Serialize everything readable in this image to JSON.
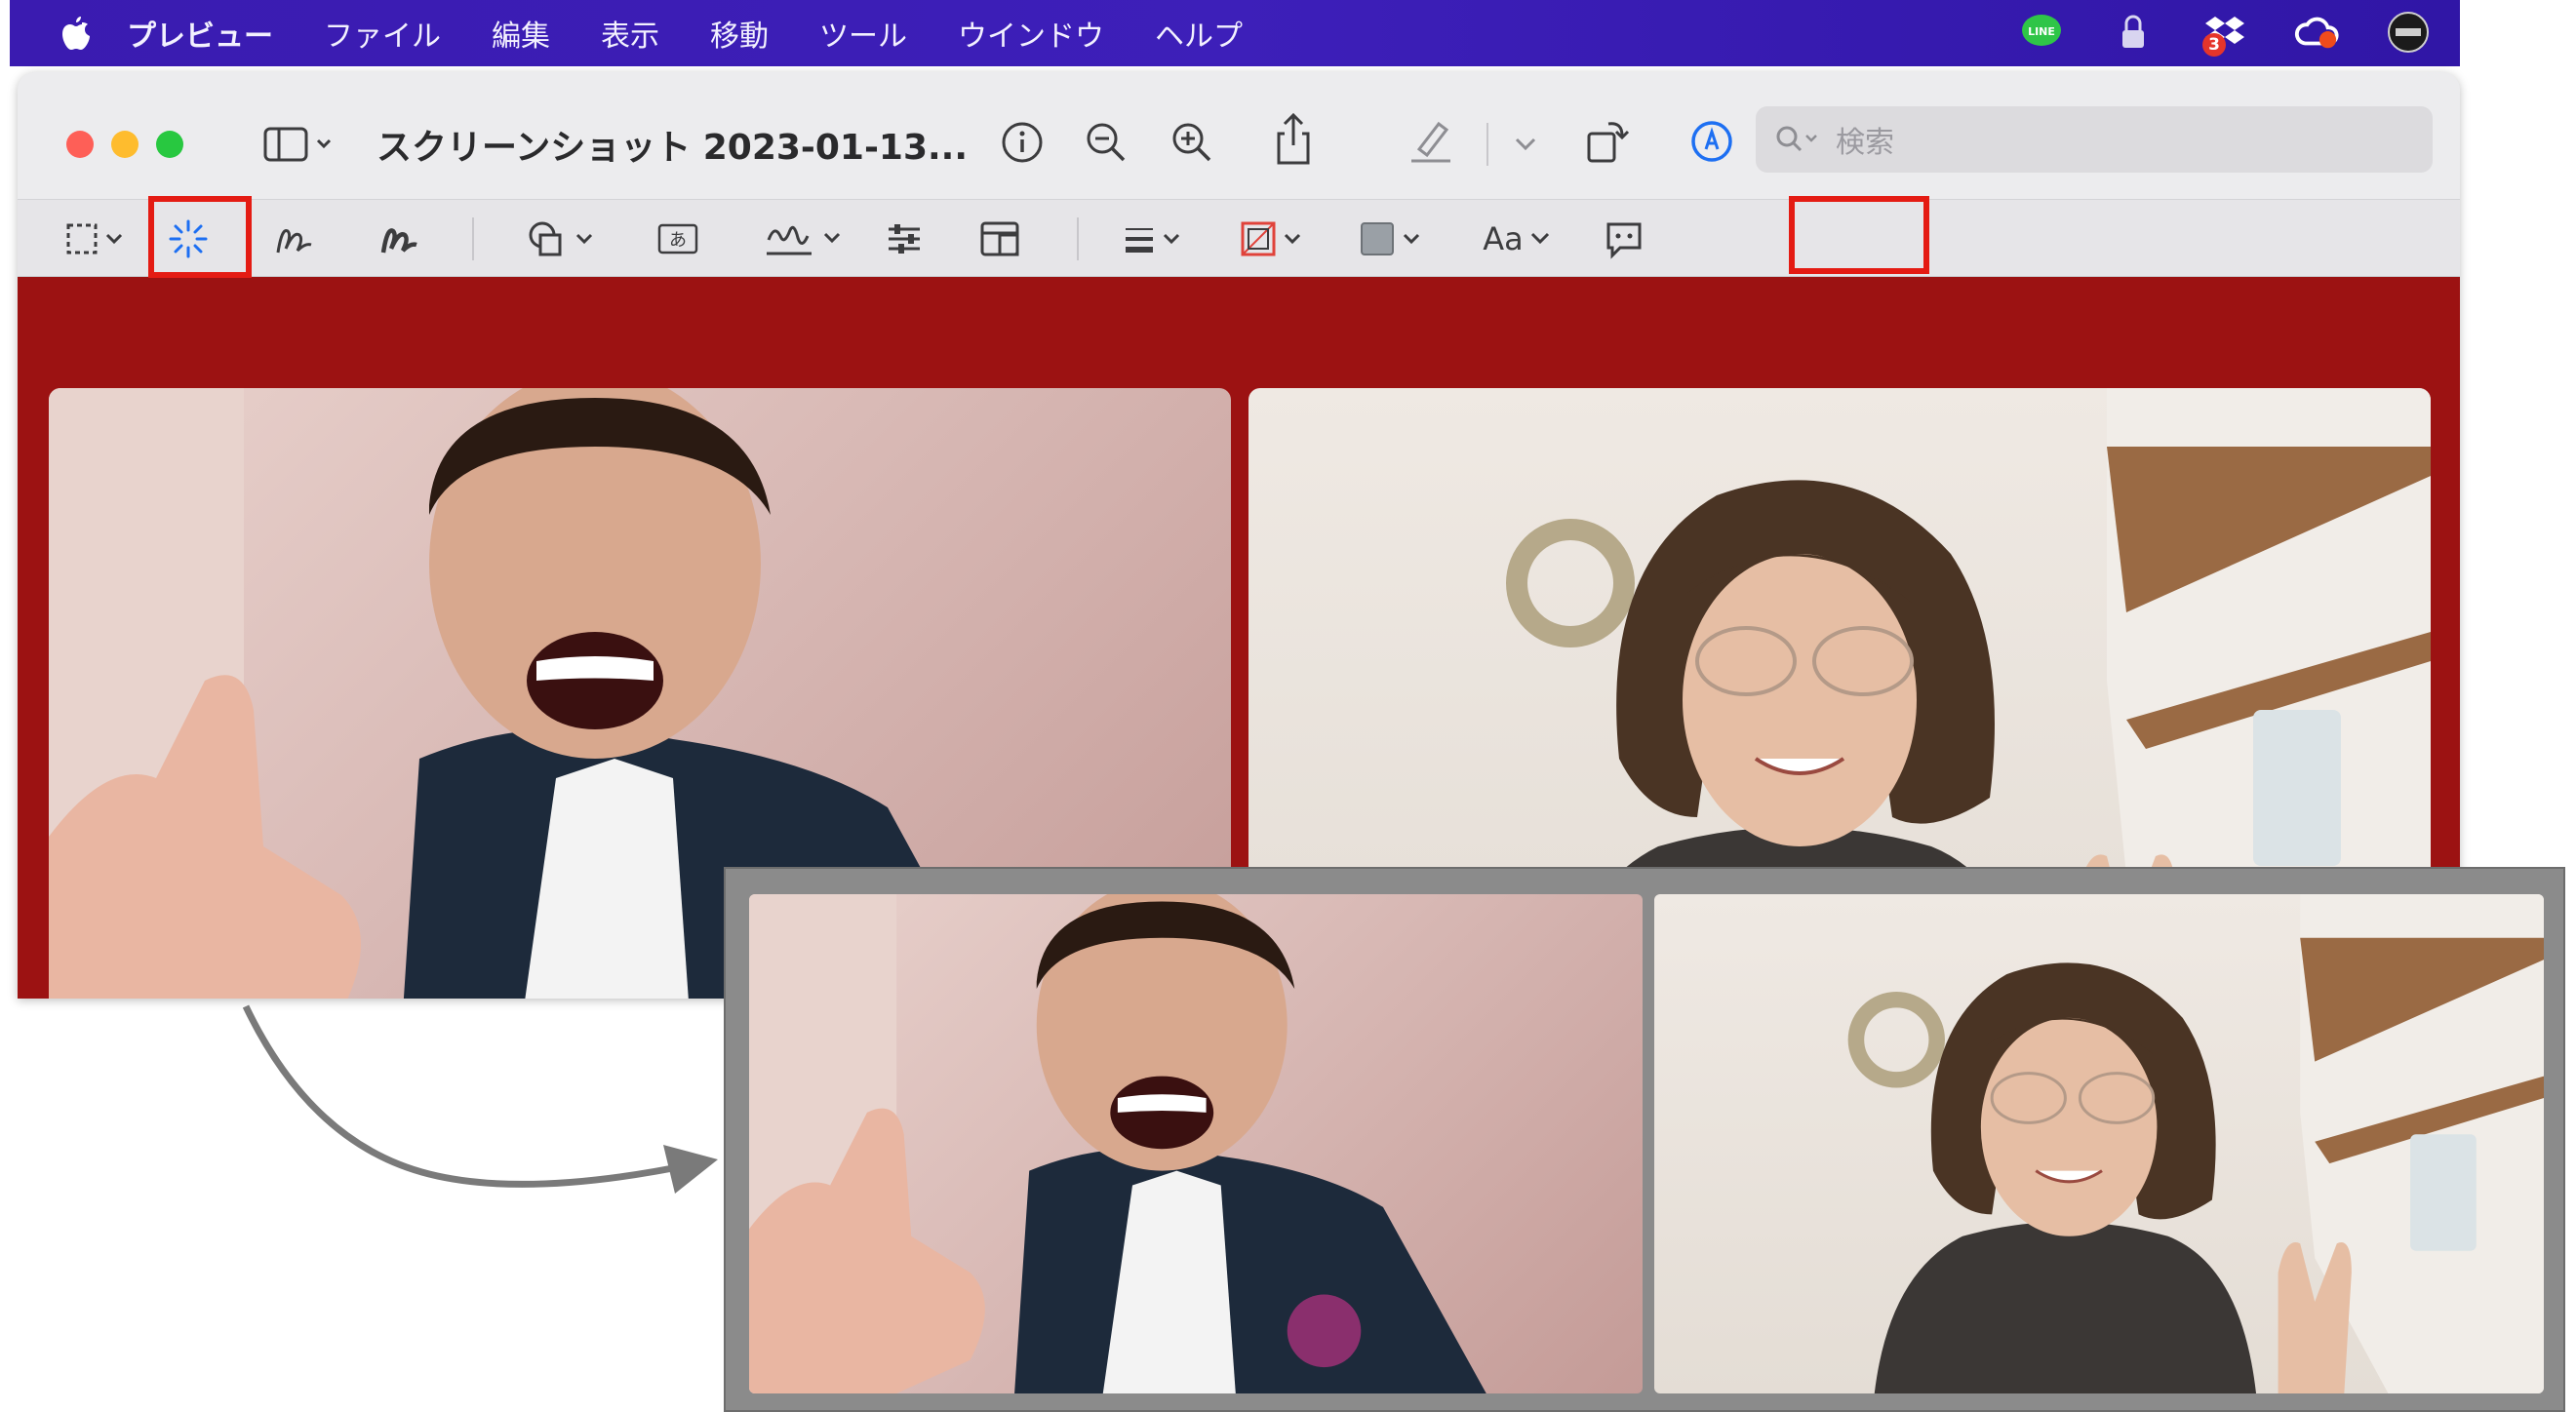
{
  "menubar": {
    "items": [
      "プレビュー",
      "ファイル",
      "編集",
      "表示",
      "移動",
      "ツール",
      "ウインドウ",
      "ヘルプ"
    ],
    "status_icons": [
      "line-icon",
      "lock-icon",
      "dropbox-icon",
      "creative-cloud-icon",
      "app-badge-icon"
    ],
    "dropbox_badge": "3",
    "line_label": "LINE"
  },
  "window": {
    "title": "スクリーンショット 2023-01-13...",
    "search_placeholder": "検索",
    "toolbar_icons": [
      "sidebar-icon",
      "info-icon",
      "zoom-out-icon",
      "zoom-in-icon",
      "share-icon",
      "highlight-icon",
      "rotate-icon",
      "markup-icon"
    ],
    "markup_icons": [
      "rect-selection-icon",
      "instant-alpha-icon",
      "sketch-icon",
      "draw-icon",
      "shapes-icon",
      "text-box-icon",
      "sign-icon",
      "adjust-color-icon",
      "adjust-size-icon",
      "line-style-icon",
      "border-color-icon",
      "fill-color-icon",
      "text-style-icon",
      "note-icon"
    ],
    "text_style_label": "Aa",
    "text_box_label": "あ"
  },
  "colors": {
    "menubar": "#3a1bb0",
    "content_bg": "#9c1212",
    "highlight_box": "#e41b13",
    "zoom_bg": "#8b8b8b",
    "arrow": "#7a7a7a"
  }
}
